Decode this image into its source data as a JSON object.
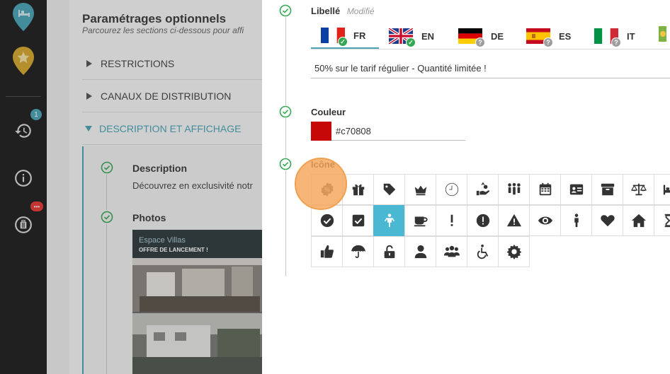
{
  "nav": {
    "history_badge": "1",
    "more_badge": "•••"
  },
  "background": {
    "title": "Paramétrages optionnels",
    "subtitle": "Parcourez les sections ci-dessous pour affi",
    "sections": [
      {
        "label": "RESTRICTIONS"
      },
      {
        "label": "CANAUX DE DISTRIBUTION"
      },
      {
        "label": "DESCRIPTION ET AFFICHAGE"
      }
    ],
    "description_label": "Description",
    "description_text": "Découvrez en exclusivité notr",
    "photos_label": "Photos",
    "photo_brand": "Espace Villas",
    "photo_caption": "OFFRE DE LANCEMENT !"
  },
  "form": {
    "libelle_label": "Libellé",
    "libelle_note": "Modifié",
    "languages": [
      {
        "code": "FR",
        "status": "ok"
      },
      {
        "code": "EN",
        "status": "ok"
      },
      {
        "code": "DE",
        "status": "missing"
      },
      {
        "code": "ES",
        "status": "missing"
      },
      {
        "code": "IT",
        "status": "missing"
      }
    ],
    "libelle_value": "50% sur le tarif régulier - Quantité limitée !",
    "color_label": "Couleur",
    "color_value": "#c70808",
    "icon_label": "Icône",
    "selected_icon": "child-icon",
    "icons_row1": [
      "percent-badge-icon",
      "gift-icon",
      "tag-icon",
      "crown-icon",
      "clock-icon",
      "hand-offer-icon",
      "group-icon",
      "calendar-icon",
      "id-card-icon",
      "archive-icon",
      "balance-scale-icon",
      "bed-icon"
    ],
    "icons_row2": [
      "check-circle-icon",
      "check-square-icon",
      "child-icon",
      "coffee-icon",
      "exclamation-icon",
      "exclamation-circle-icon",
      "warning-icon",
      "eye-icon",
      "person-standing-icon",
      "heart-icon",
      "home-icon",
      "hourglass-icon"
    ],
    "icons_row3": [
      "thumbs-up-icon",
      "umbrella-icon",
      "unlock-icon",
      "user-icon",
      "users-icon",
      "wheelchair-icon",
      "gear-badge-icon"
    ]
  },
  "colors": {
    "accent": "#4aa3b5",
    "check_green": "#34a853",
    "selected_icon_bg": "#4ab8d3",
    "nav_bg": "#1f1f1f",
    "nav_marker_blue": "#4aa3b5",
    "nav_marker_gold": "#d4a72c",
    "notification_red": "#e53935"
  }
}
